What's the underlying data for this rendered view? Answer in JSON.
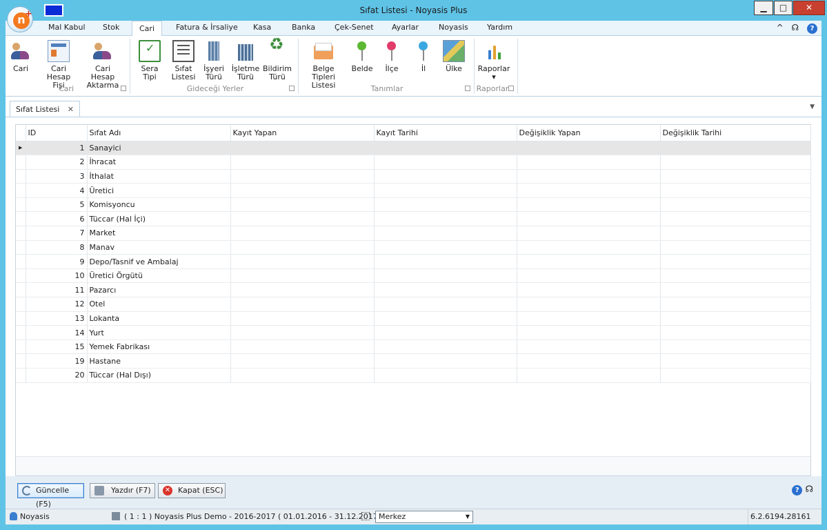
{
  "window": {
    "title": "Sıfat Listesi - Noyasis Plus",
    "minimize": "▁",
    "maximize": "□",
    "close": "✕"
  },
  "ribbon_tabs": [
    {
      "label": "Mal Kabul"
    },
    {
      "label": "Stok"
    },
    {
      "label": "Cari",
      "active": true
    },
    {
      "label": "Fatura & İrsaliye"
    },
    {
      "label": "Kasa"
    },
    {
      "label": "Banka"
    },
    {
      "label": "Çek-Senet"
    },
    {
      "label": "Ayarlar"
    },
    {
      "label": "Noyasis"
    },
    {
      "label": "Yardım"
    }
  ],
  "ribbon_right": {
    "collapse": "^",
    "support": "☊",
    "help": "?"
  },
  "ribbon_buttons": {
    "cari": "Cari",
    "cari_hesap_fisi_1": "Cari Hesap",
    "cari_hesap_fisi_2": "Fişi",
    "cari_hesap_aktarma_1": "Cari Hesap",
    "cari_hesap_aktarma_2": "Aktarma",
    "sera_tipi": "Sera Tipi",
    "sifat_listesi_1": "Sıfat",
    "sifat_listesi_2": "Listesi",
    "isyeri_turu_1": "İşyeri",
    "isyeri_turu_2": "Türü",
    "isletme_turu_1": "İşletme",
    "isletme_turu_2": "Türü",
    "bildirim_turu_1": "Bildirim",
    "bildirim_turu_2": "Türü",
    "belge_tipleri_1": "Belge Tipleri",
    "belge_tipleri_2": "Listesi",
    "belde": "Belde",
    "ilce": "İlçe",
    "il": "İl",
    "ulke": "Ülke",
    "raporlar": "Raporlar",
    "raporlar_arrow": "▾"
  },
  "ribbon_groups": {
    "cari": "Cari",
    "gidecegi_yerler": "Gideceği Yerler",
    "tanimlar": "Tanımlar",
    "raporlar": "Raporlar"
  },
  "colors": {
    "pin_green": "#5cb832",
    "pin_red": "#e23c6a",
    "pin_blue": "#3aa8e0"
  },
  "doc_tab": {
    "label": "Sıfat Listesi",
    "close": "✕",
    "menu": "▼"
  },
  "grid": {
    "columns": [
      "ID",
      "Sıfat Adı",
      "Kayıt Yapan",
      "Kayıt Tarihi",
      "Değişiklik Yapan",
      "Değişiklik Tarihi"
    ],
    "row_indicator": "▶",
    "rows": [
      {
        "id": "1",
        "name": "Sanayici"
      },
      {
        "id": "2",
        "name": "İhracat"
      },
      {
        "id": "3",
        "name": "İthalat"
      },
      {
        "id": "4",
        "name": "Üretici"
      },
      {
        "id": "5",
        "name": "Komisyoncu"
      },
      {
        "id": "6",
        "name": "Tüccar (Hal İçi)"
      },
      {
        "id": "7",
        "name": "Market"
      },
      {
        "id": "8",
        "name": "Manav"
      },
      {
        "id": "9",
        "name": "Depo/Tasnif ve Ambalaj"
      },
      {
        "id": "10",
        "name": "Üretici Örgütü"
      },
      {
        "id": "11",
        "name": "Pazarcı"
      },
      {
        "id": "12",
        "name": "Otel"
      },
      {
        "id": "13",
        "name": "Lokanta"
      },
      {
        "id": "14",
        "name": "Yurt"
      },
      {
        "id": "15",
        "name": "Yemek Fabrikası"
      },
      {
        "id": "19",
        "name": "Hastane"
      },
      {
        "id": "20",
        "name": "Tüccar (Hal Dışı)"
      }
    ]
  },
  "buttons": {
    "guncelle": "Güncelle (F5)",
    "yazdir": "Yazdır (F7)",
    "kapat": "Kapat (ESC)",
    "kapat_icon": "✕"
  },
  "status": {
    "user": "Noyasis",
    "company": "( 1 : 1 )  Noyasis Plus Demo - 2016-2017  ( 01.01.2016 - 31.12.2017 )",
    "branch": "Merkez",
    "branch_arrow": "▼",
    "version": "6.2.6194.28161"
  }
}
